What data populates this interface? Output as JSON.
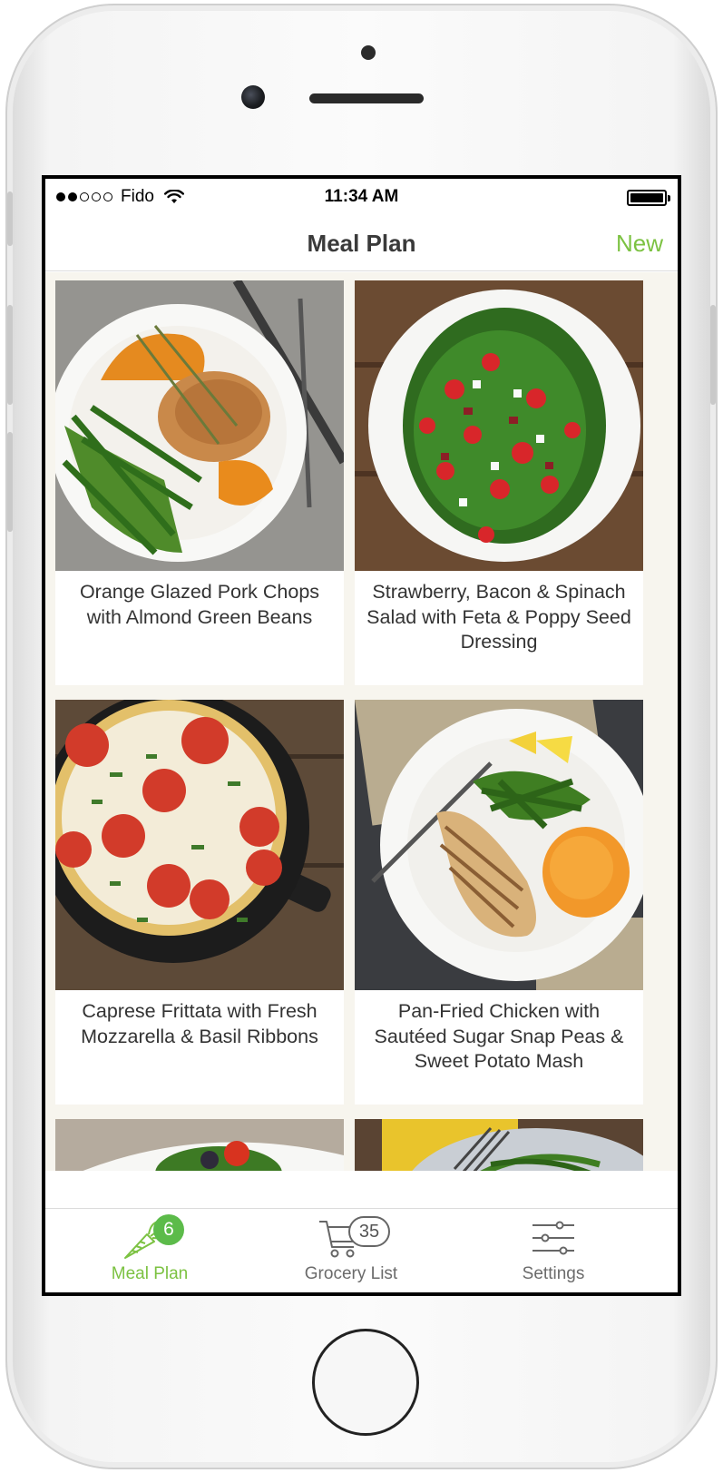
{
  "status_bar": {
    "carrier": "Fido",
    "time": "11:34 AM"
  },
  "nav": {
    "title": "Meal Plan",
    "new_label": "New"
  },
  "meals": [
    {
      "title": "Orange Glazed Pork Chops with Almond Green Beans"
    },
    {
      "title": "Strawberry, Bacon & Spinach Salad with Feta & Poppy Seed Dressing"
    },
    {
      "title": "Caprese Frittata with Fresh Mozzarella & Basil Ribbons"
    },
    {
      "title": "Pan-Fried Chicken with Sautéed Sugar Snap Peas & Sweet Potato Mash"
    }
  ],
  "tabs": [
    {
      "label": "Meal Plan",
      "badge": "6",
      "icon": "carrot-icon",
      "active": true
    },
    {
      "label": "Grocery List",
      "badge": "35",
      "icon": "cart-icon",
      "active": false
    },
    {
      "label": "Settings",
      "icon": "sliders-icon",
      "active": false
    }
  ],
  "colors": {
    "accent": "#7cc242",
    "badge_green": "#5cbb4a",
    "content_bg": "#f7f5ee"
  }
}
